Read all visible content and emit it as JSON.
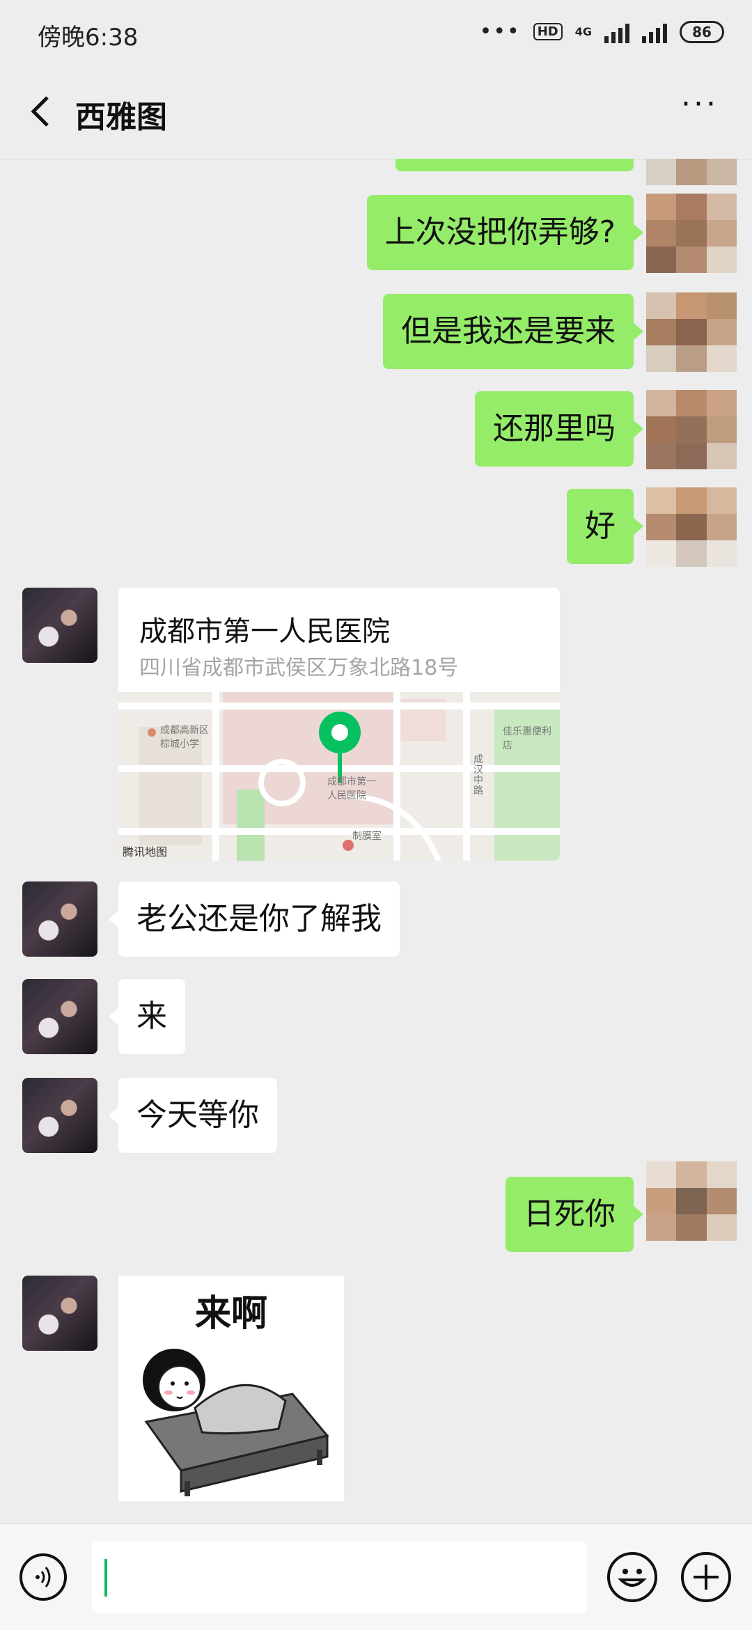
{
  "status_bar": {
    "time": "傍晚6:38",
    "hd_badge": "HD",
    "network": "4G",
    "battery": "86"
  },
  "header": {
    "title": "西雅图",
    "more": "···"
  },
  "messages": [
    {
      "side": "right",
      "text": "上次没把你弄够?"
    },
    {
      "side": "right",
      "text": "但是我还是要来"
    },
    {
      "side": "right",
      "text": "还那里吗"
    },
    {
      "side": "right",
      "text": "好"
    },
    {
      "side": "left",
      "type": "location",
      "name": "成都市第一人民医院",
      "address": "四川省成都市武侯区万象北路18号",
      "map": {
        "labels": {
          "school": "成都高新区\n棕城小学",
          "hospital": "成都市第一\n人民医院",
          "convenience": "佳乐惠便利店",
          "road": "成汉中路",
          "pharmacy": "制膜室",
          "brand": "腾讯地图"
        }
      }
    },
    {
      "side": "left",
      "text": "老公还是你了解我"
    },
    {
      "side": "left",
      "text": "来"
    },
    {
      "side": "left",
      "text": "今天等你"
    },
    {
      "side": "right",
      "text": "日死你"
    },
    {
      "side": "left",
      "type": "sticker",
      "caption": "来啊"
    }
  ],
  "input_bar": {
    "value": ""
  },
  "colors": {
    "background": "#ededed",
    "self_bubble": "#95ec69",
    "other_bubble": "#ffffff",
    "cursor": "#07c160"
  }
}
